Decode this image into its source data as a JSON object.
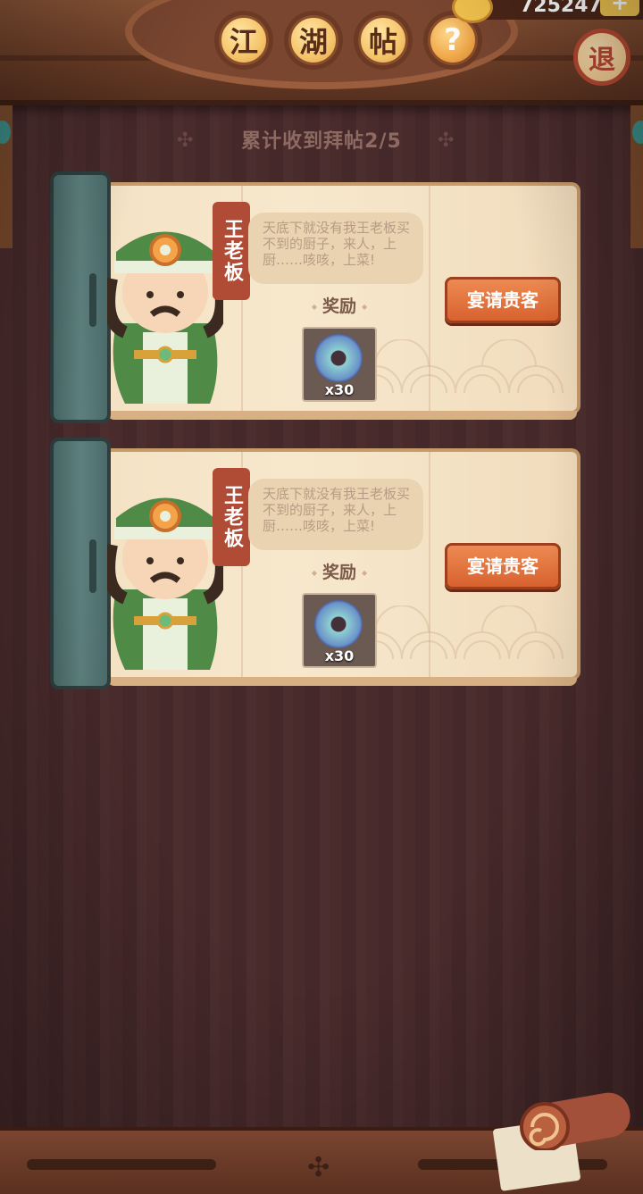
{
  "header": {
    "title_chars": [
      "江",
      "湖",
      "帖"
    ],
    "help_symbol": "?",
    "coins": "725247",
    "add_symbol": "+",
    "exit_label": "退"
  },
  "summary": {
    "text": "累计收到拜帖2/5"
  },
  "cards": [
    {
      "name": "王老板",
      "quote": "天底下就没有我王老板买不到的厨子，来人，上厨……咳咳，上菜!",
      "reward_label": "奖励",
      "reward_qty": "x30",
      "button": "宴请贵客"
    },
    {
      "name": "王老板",
      "quote": "天底下就没有我王老板买不到的厨子，来人，上厨……咳咳，上菜!",
      "reward_label": "奖励",
      "reward_qty": "x30",
      "button": "宴请贵客"
    }
  ],
  "icons": {
    "coin": "coin-icon",
    "scroll": "scroll-icon",
    "reward_item": "jade-disc-icon"
  },
  "colors": {
    "button": "#d8622f",
    "title_button": "#f5c46a",
    "binder": "#5f8280"
  }
}
